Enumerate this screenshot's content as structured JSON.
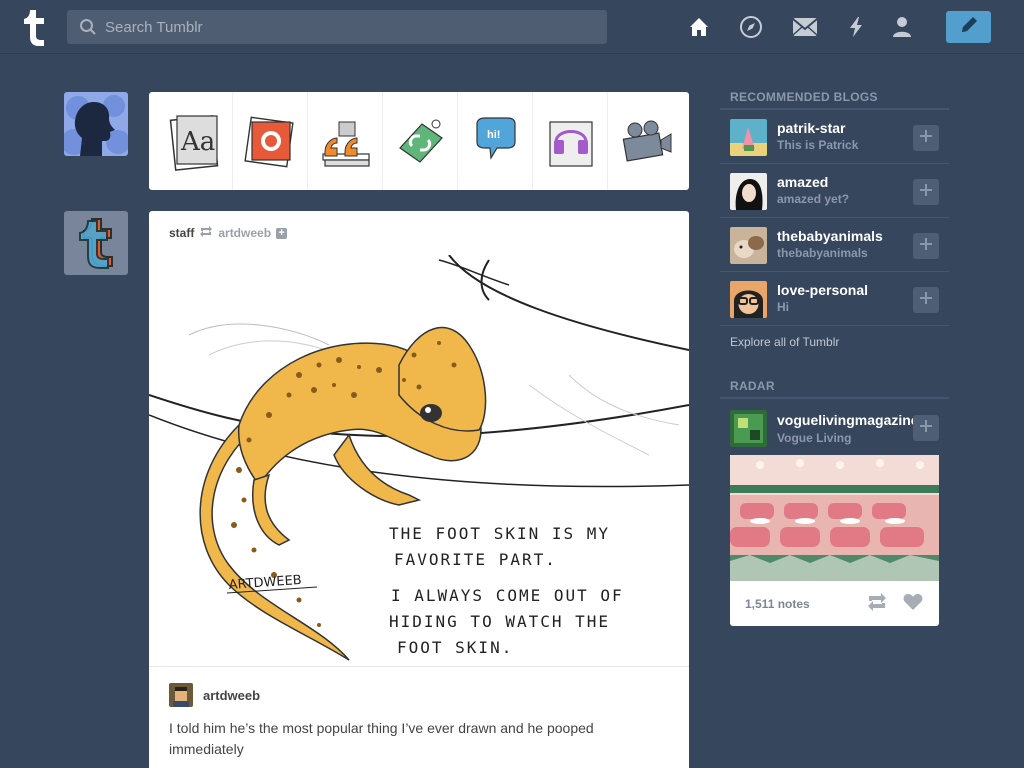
{
  "header": {
    "search_placeholder": "Search Tumblr",
    "nav": [
      "home-icon",
      "explore-compass-icon",
      "inbox-mail-icon",
      "activity-lightning-icon",
      "account-person-icon"
    ],
    "compose": "pencil-icon"
  },
  "post_types": [
    "text",
    "photo",
    "quote",
    "link",
    "chat",
    "audio",
    "video"
  ],
  "post": {
    "poster": "staff",
    "reblogged_from": "artdweeb",
    "art_signature": "ARTDWEEB",
    "art_text_lines": [
      "THE FOOT SKIN IS MY",
      "FAVORITE PART.",
      "I ALWAYS COME OUT OF",
      "HIDING TO WATCH THE",
      "FOOT SKIN."
    ],
    "reblog_user": "artdweeb",
    "caption": "I told him he’s the most popular thing I’ve ever drawn and he pooped immediately"
  },
  "sidebar": {
    "recommended_title": "RECOMMENDED BLOGS",
    "blogs": [
      {
        "name": "patrik-star",
        "desc": "This is Patrick"
      },
      {
        "name": "amazed",
        "desc": "amazed yet?"
      },
      {
        "name": "thebabyanimals",
        "desc": "thebabyanimals"
      },
      {
        "name": "love-personal",
        "desc": "Hi"
      }
    ],
    "explore": "Explore all of Tumblr",
    "radar_title": "RADAR",
    "radar": {
      "name": "voguelivingmagazine",
      "desc": "Vogue Living",
      "notes": "1,511 notes"
    }
  },
  "colors": {
    "background": "#36465d",
    "accent": "#529ecc"
  }
}
